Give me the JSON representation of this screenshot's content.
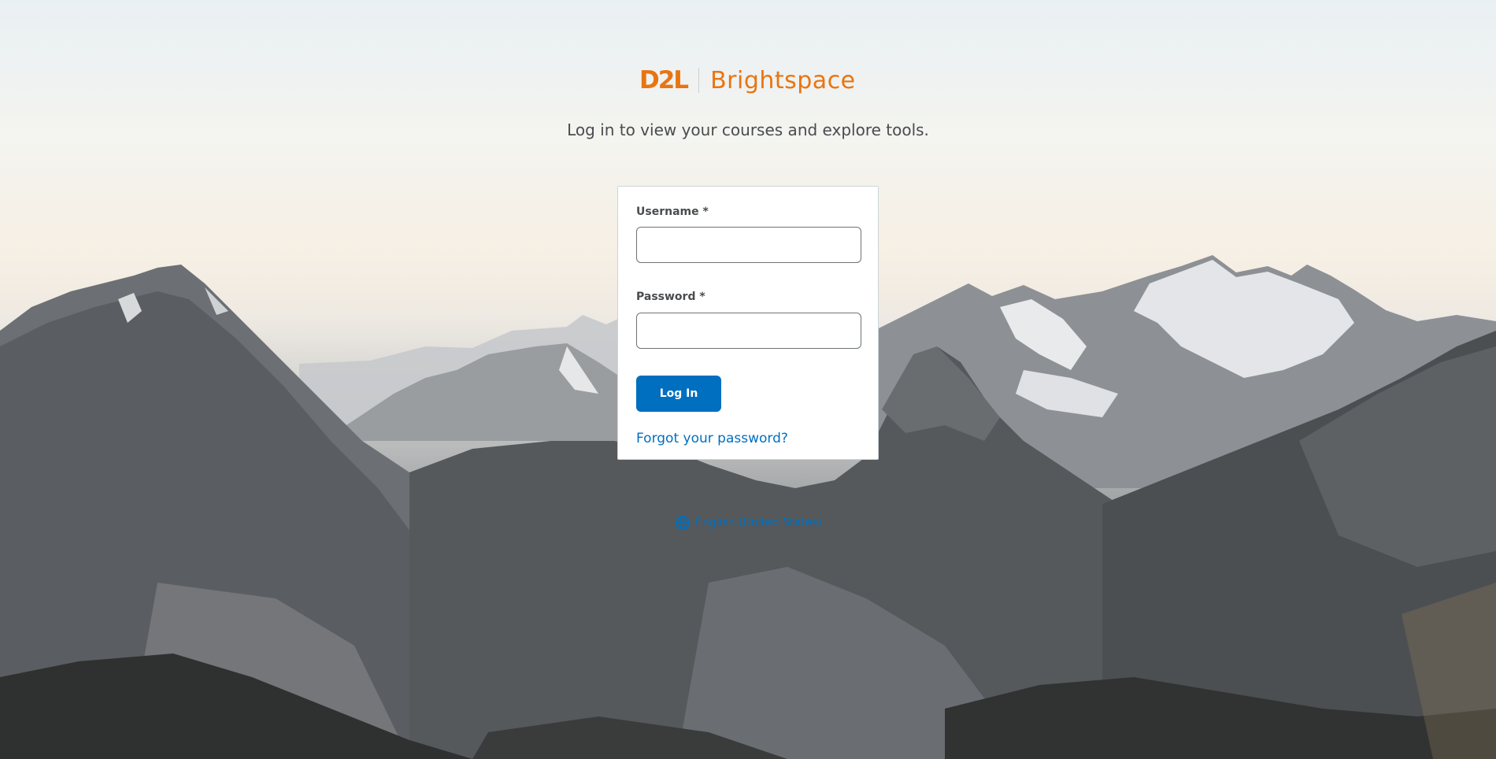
{
  "brand": {
    "logo_mark": "D2L",
    "product_name": "Brightspace",
    "accent_color": "#e87511"
  },
  "tagline": "Log in to view your courses and explore tools.",
  "login_form": {
    "username_label": "Username *",
    "username_value": "",
    "password_label": "Password *",
    "password_value": "",
    "login_button": "Log In",
    "forgot_link": "Forgot your password?",
    "primary_color": "#006fbf"
  },
  "language_selector": {
    "icon": "globe-icon",
    "label": "English (United States)"
  },
  "background": {
    "scene": "mountain-landscape"
  }
}
